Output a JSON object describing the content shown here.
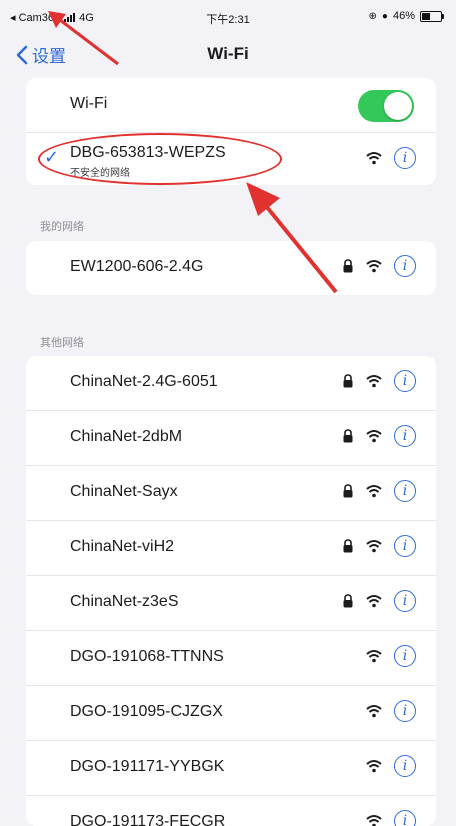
{
  "status_bar": {
    "carrier": "◂ Cam365",
    "network": "4G",
    "time": "下午2:31",
    "battery": "46%",
    "battery_level": 0.46
  },
  "nav": {
    "back_label": "设置",
    "title": "Wi-Fi"
  },
  "wifi_toggle": {
    "label": "Wi-Fi",
    "on": true
  },
  "connected": {
    "name": "DBG-653813-WEPZS",
    "subtitle": "不安全的网络"
  },
  "my_networks": {
    "header": "我的网络",
    "items": [
      {
        "name": "EW1200-606-2.4G",
        "locked": true
      }
    ]
  },
  "other_networks": {
    "header": "其他网络",
    "items": [
      {
        "name": "ChinaNet-2.4G-6051",
        "locked": true
      },
      {
        "name": "ChinaNet-2dbM",
        "locked": true
      },
      {
        "name": "ChinaNet-Sayx",
        "locked": true
      },
      {
        "name": "ChinaNet-viH2",
        "locked": true
      },
      {
        "name": "ChinaNet-z3eS",
        "locked": true
      },
      {
        "name": "DGO-191068-TTNNS",
        "locked": false
      },
      {
        "name": "DGO-191095-CJZGX",
        "locked": false
      },
      {
        "name": "DGO-191171-YYBGK",
        "locked": false
      },
      {
        "name": "DGO-191173-FECGR",
        "locked": false
      }
    ]
  },
  "colors": {
    "accent": "#2f6bd6",
    "toggle_on": "#34c759",
    "annotation": "#e0322f"
  }
}
